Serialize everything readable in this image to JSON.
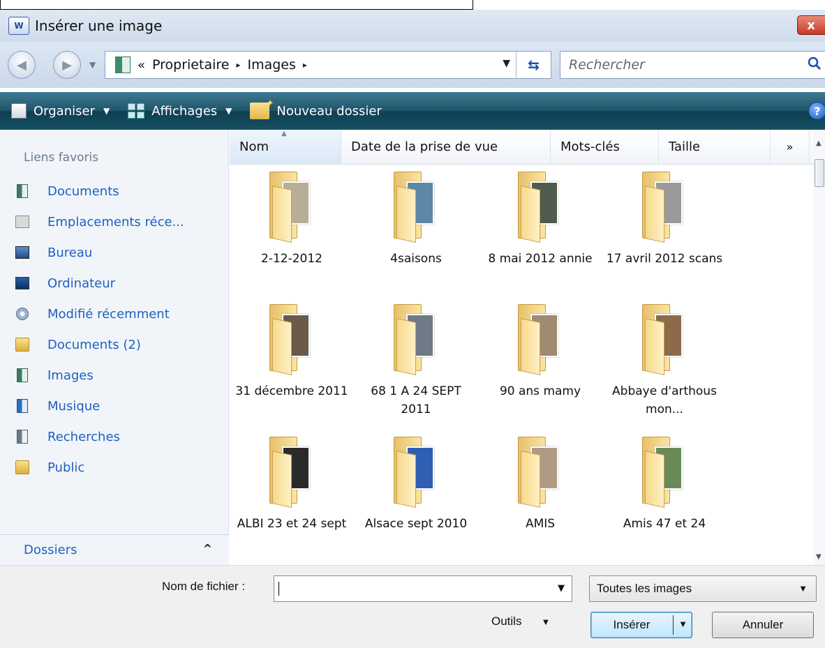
{
  "window": {
    "title": "Insérer une image",
    "app_icon": "word-document-icon",
    "close_label": "x"
  },
  "address": {
    "prefix": "«",
    "segments": [
      "Proprietaire",
      "Images"
    ],
    "separator": "▸",
    "search_placeholder": "Rechercher"
  },
  "toolbar": {
    "organise": "Organiser",
    "views": "Affichages",
    "new_folder": "Nouveau dossier",
    "help": "?"
  },
  "nav": {
    "heading": "Liens favoris",
    "items": [
      {
        "label": "Documents",
        "icon": "documents-icon"
      },
      {
        "label": "Emplacements réce...",
        "icon": "recent-places-icon"
      },
      {
        "label": "Bureau",
        "icon": "desktop-icon"
      },
      {
        "label": "Ordinateur",
        "icon": "computer-icon"
      },
      {
        "label": "Modifié récemment",
        "icon": "recently-changed-icon"
      },
      {
        "label": "Documents (2)",
        "icon": "folder-icon"
      },
      {
        "label": "Images",
        "icon": "pictures-icon"
      },
      {
        "label": "Musique",
        "icon": "music-icon"
      },
      {
        "label": "Recherches",
        "icon": "searches-icon"
      },
      {
        "label": "Public",
        "icon": "folder-icon"
      }
    ],
    "folders_label": "Dossiers",
    "folders_chevron": "^"
  },
  "columns": {
    "name": "Nom",
    "date": "Date de la prise de vue",
    "keywords": "Mots-clés",
    "size": "Taille",
    "more": "»"
  },
  "folders": [
    {
      "name": "2-12-2012",
      "photo": "#b8ad95"
    },
    {
      "name": "4saisons",
      "photo": "#5d87a8"
    },
    {
      "name": "8 mai 2012 annie",
      "photo": "#4f5b4d"
    },
    {
      "name": "17 avril 2012 scans",
      "photo": "#9a9a9a"
    },
    {
      "name": "31 décembre 2011",
      "photo": "#6a5a4a"
    },
    {
      "name": "68 1 A 24 SEPT 2011",
      "photo": "#6f7a86"
    },
    {
      "name": "90 ans mamy",
      "photo": "#a08a70"
    },
    {
      "name": "Abbaye d'arthous mon...",
      "photo": "#8b6b4a"
    },
    {
      "name": "ALBI 23 et 24 sept",
      "photo": "#2a2a2a"
    },
    {
      "name": "Alsace sept 2010",
      "photo": "#2f5fb3"
    },
    {
      "name": "AMIS",
      "photo": "#b09a86"
    },
    {
      "name": "Amis 47 et 24",
      "photo": "#6b8a5a"
    }
  ],
  "footer": {
    "filename_label": "Nom de fichier :",
    "filename_value": "",
    "filetype": "Toutes les images",
    "tools": "Outils",
    "insert": "Insérer",
    "cancel": "Annuler"
  }
}
